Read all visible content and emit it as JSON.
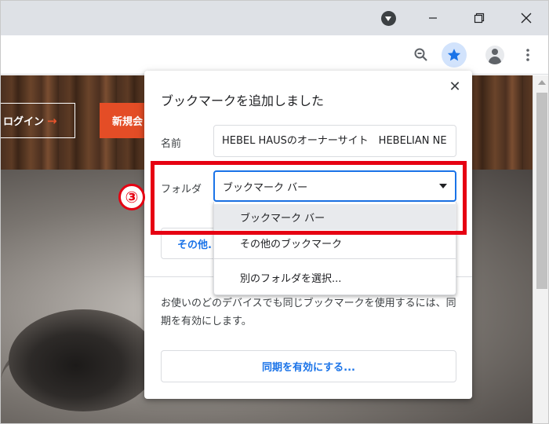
{
  "page": {
    "login_label": "ログイン",
    "login_arrow": "→",
    "new_label": "新規会"
  },
  "dialog": {
    "title": "ブックマークを追加しました",
    "close": "✕",
    "name_label": "名前",
    "name_value": "HEBEL HAUSのオーナーサイト　HEBELIAN NE",
    "folder_label": "フォルダ",
    "folder_value": "ブックマーク バー",
    "other_button": "その他.",
    "sync_text": "お使いのどのデバイスでも同じブックマークを使用するには、同期を有効にします。",
    "sync_button": "同期を有効にする..."
  },
  "dropdown": {
    "options": [
      "ブックマーク バー",
      "その他のブックマーク"
    ],
    "choose_other": "別のフォルダを選択...",
    "selected_index": 0
  },
  "annotation": {
    "step": "③"
  },
  "colors": {
    "accent": "#1a73e8",
    "annotation": "#e60012",
    "brand": "#e44d26"
  }
}
